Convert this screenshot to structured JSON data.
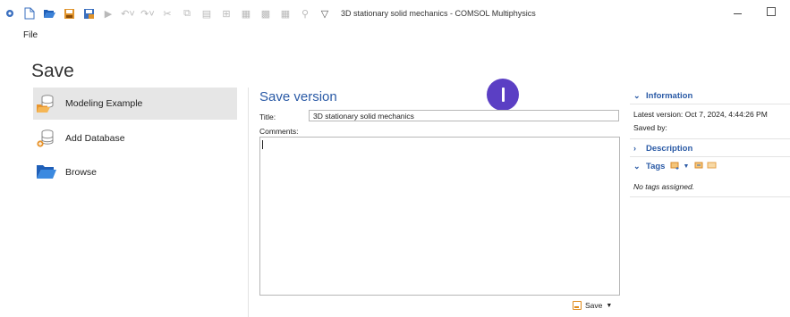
{
  "window": {
    "title": "3D stationary solid mechanics - COMSOL Multiphysics",
    "toolbar_icons": [
      "app-icon",
      "new-icon",
      "open-icon",
      "save-icon",
      "save-as-icon",
      "run-icon",
      "undo-icon",
      "redo-icon",
      "cut-icon",
      "copy-icon",
      "paste-icon",
      "duplicate-icon",
      "delete-icon",
      "build-icon",
      "compute-icon",
      "study-icon",
      "customize-icon"
    ]
  },
  "menu": {
    "file": "File"
  },
  "left": {
    "heading": "Save",
    "items": [
      {
        "label": "Modeling Example",
        "icon": "database-folder-icon",
        "selected": true
      },
      {
        "label": "Add Database",
        "icon": "add-database-icon",
        "selected": false
      },
      {
        "label": "Browse",
        "icon": "folder-icon",
        "selected": false
      }
    ]
  },
  "form": {
    "heading": "Save version",
    "title_label": "Title:",
    "title_value": "3D stationary solid mechanics",
    "comments_label": "Comments:",
    "comments_value": "",
    "save_button": "Save",
    "avatar_initial": "I"
  },
  "info": {
    "information_header": "Information",
    "latest_version": "Latest version:  Oct 7, 2024, 4:44:26 PM",
    "saved_by": "Saved by:",
    "description_header": "Description",
    "tags_header": "Tags",
    "tags_empty": "No tags assigned."
  },
  "colors": {
    "accent": "#2a5aa6",
    "avatar": "#5b3fc4",
    "folder": "#f2a83a"
  }
}
